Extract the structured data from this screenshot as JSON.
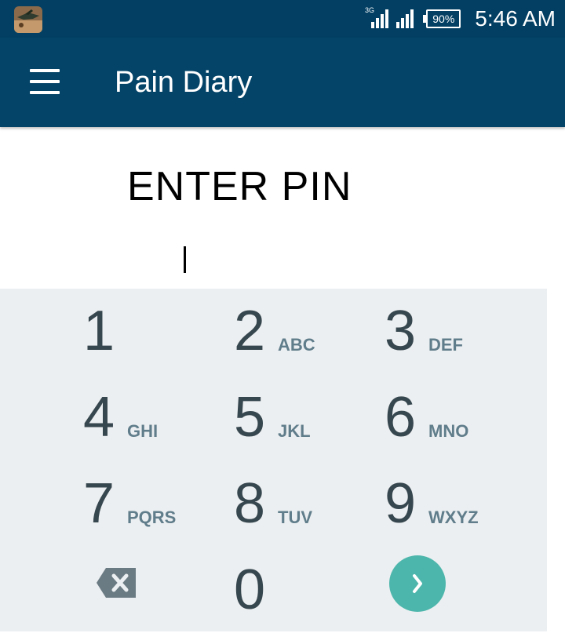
{
  "status_bar": {
    "network": "3G",
    "battery": "90%",
    "time": "5:46 AM",
    "app_icon": "game-app-icon"
  },
  "toolbar": {
    "menu_icon": "hamburger-menu-icon",
    "title": "Pain Diary"
  },
  "pin": {
    "title": "ENTER PIN",
    "value": ""
  },
  "keypad": {
    "keys": [
      {
        "digit": "1",
        "letters": ""
      },
      {
        "digit": "2",
        "letters": "ABC"
      },
      {
        "digit": "3",
        "letters": "DEF"
      },
      {
        "digit": "4",
        "letters": "GHI"
      },
      {
        "digit": "5",
        "letters": "JKL"
      },
      {
        "digit": "6",
        "letters": "MNO"
      },
      {
        "digit": "7",
        "letters": "PQRS"
      },
      {
        "digit": "8",
        "letters": "TUV"
      },
      {
        "digit": "9",
        "letters": "WXYZ"
      },
      {
        "digit": "0",
        "letters": ""
      }
    ],
    "backspace_icon": "backspace-icon",
    "enter_icon": "chevron-right-icon",
    "accent_color": "#4db6ac"
  },
  "colors": {
    "status_bar": "#023f63",
    "toolbar": "#044468",
    "input_underline": "#159a8f",
    "keypad_bg": "#eceff1"
  }
}
